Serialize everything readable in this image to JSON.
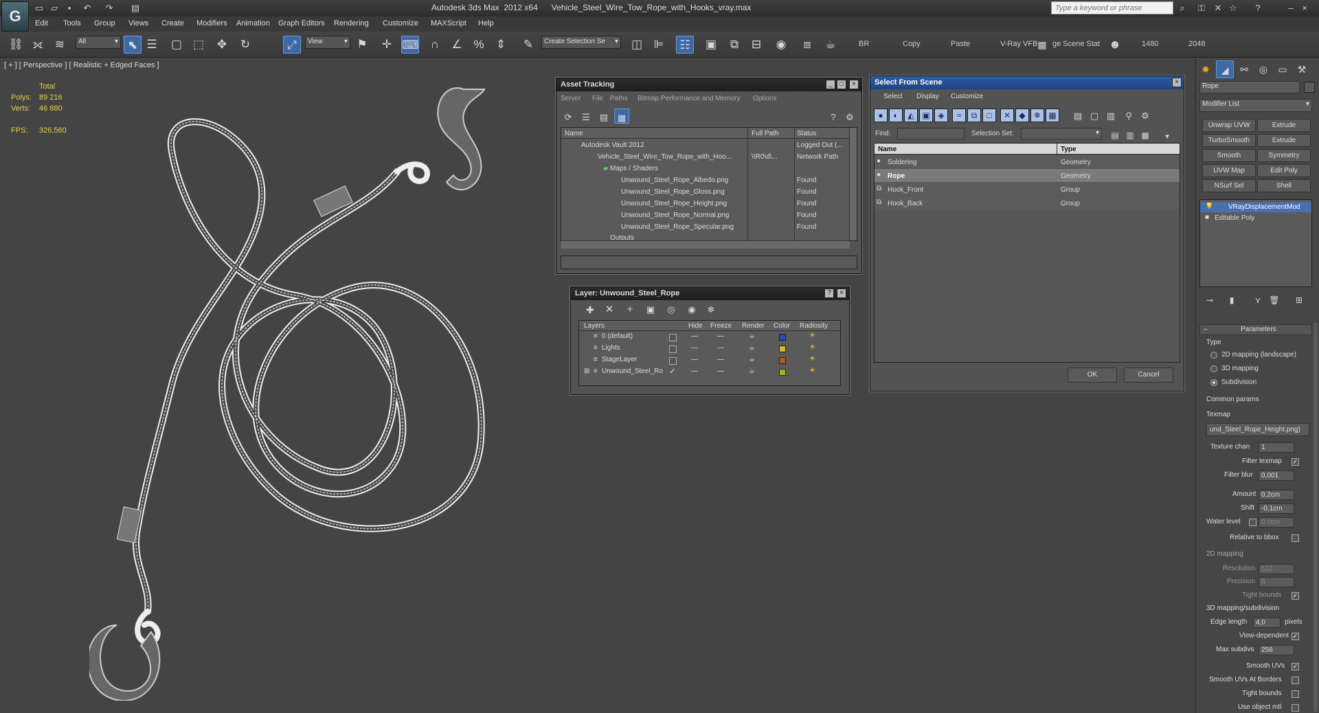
{
  "titlebar": {
    "app": "Autodesk 3ds Max  2012 x64",
    "file": "Vehicle_Steel_Wire_Tow_Rope_with_Hooks_vray.max",
    "search_placeholder": "Type a keyword or phrase"
  },
  "menu": [
    "Edit",
    "Tools",
    "Group",
    "Views",
    "Create",
    "Modifiers",
    "Animation",
    "Graph Editors",
    "Rendering",
    "Customize",
    "MAXScript",
    "Help"
  ],
  "toolbar": {
    "filter": "All",
    "view": "View",
    "selection_set": "Create Selection Se",
    "br": "BR",
    "copy": "Copy",
    "paste": "Paste",
    "vfb": "V-Ray VFB",
    "scene_stat": "ge Scene Stat",
    "w": "1480",
    "h": "2048"
  },
  "viewport": {
    "label": "[ + ] [ Perspective ] [ Realistic + Edged Faces ]",
    "total": "Total",
    "polys_label": "Polys:",
    "polys": "89 216",
    "verts_label": "Verts:",
    "verts": "46 880",
    "fps_label": "FPS:",
    "fps": "326,560"
  },
  "asset_tracking": {
    "title": "Asset Tracking",
    "menus": [
      "Server",
      "File",
      "Paths",
      "Bitmap Performance and Memory",
      "Options"
    ],
    "headers": [
      "Name",
      "Full Path",
      "Status"
    ],
    "rows": [
      {
        "name": "Autodesk Vault 2012",
        "path": "",
        "status": "Logged Out (..."
      },
      {
        "name": "Vehicle_Steel_Wire_Tow_Rope_with_Hoo...",
        "path": "\\\\R0\\d\\...",
        "status": "Network Path"
      },
      {
        "name": "Maps / Shaders",
        "path": "",
        "status": ""
      },
      {
        "name": "Unwound_Steel_Rope_Albedo.png",
        "path": "",
        "status": "Found"
      },
      {
        "name": "Unwound_Steel_Rope_Gloss.png",
        "path": "",
        "status": "Found"
      },
      {
        "name": "Unwound_Steel_Rope_Height.png",
        "path": "",
        "status": "Found"
      },
      {
        "name": "Unwound_Steel_Rope_Normal.png",
        "path": "",
        "status": "Found"
      },
      {
        "name": "Unwound_Steel_Rope_Specular.png",
        "path": "",
        "status": "Found"
      },
      {
        "name": "Outputs",
        "path": "",
        "status": ""
      }
    ]
  },
  "select_scene": {
    "title": "Select From Scene",
    "menus": [
      "Select",
      "Display",
      "Customize"
    ],
    "find_label": "Find:",
    "selset_label": "Selection Set:",
    "headers": [
      "Name",
      "Type"
    ],
    "rows": [
      {
        "name": "Soldering",
        "type": "Geometry"
      },
      {
        "name": "Rope",
        "type": "Geometry"
      },
      {
        "name": "Hook_Front",
        "type": "Group"
      },
      {
        "name": "Hook_Back",
        "type": "Group"
      }
    ],
    "ok": "OK",
    "cancel": "Cancel"
  },
  "layer": {
    "title": "Layer: Unwound_Steel_Rope",
    "headers": [
      "Layers",
      "Hide",
      "Freeze",
      "Render",
      "Color",
      "Radiosity"
    ],
    "rows": [
      {
        "name": "0 (default)",
        "color": "#2a4ab0"
      },
      {
        "name": "Lights",
        "color": "#d8b428"
      },
      {
        "name": "StageLayer",
        "color": "#b4561c"
      },
      {
        "name": "Unwound_Steel_Ro",
        "color": "#9ab820"
      }
    ]
  },
  "cmd": {
    "object_name": "Rope",
    "modifier_list": "Modifier List",
    "buttons": [
      "Unwrap UVW",
      "Extrude",
      "TurboSmooth",
      "Extrude",
      "Smooth",
      "Symmetry",
      "UVW Map",
      "Edit Poly",
      "NSurf Sel",
      "Shell"
    ],
    "stack": [
      "VRayDisplacementMod",
      "Editable Poly"
    ],
    "params_title": "Parameters",
    "type_label": "Type",
    "type_opts": [
      "2D mapping (landscape)",
      "3D mapping",
      "Subdivision"
    ],
    "common": "Common params",
    "texmap": "Texmap",
    "texmap_val": "und_Steel_Rope_Height.png)",
    "texture_chan": "Texture chan",
    "texture_chan_val": "1",
    "filter_texmap": "Filter texmap",
    "filter_blur": "Filter blur",
    "filter_blur_val": "0,001",
    "amount": "Amount",
    "amount_val": "0,2cm",
    "shift": "Shift",
    "shift_val": "-0,1cm",
    "water": "Water level",
    "water_val": "0,0cm",
    "relative": "Relative to bbox",
    "map2d": "2D mapping",
    "resolution": "Resolution",
    "resolution_val": "512",
    "precision": "Precision",
    "precision_val": "8",
    "tight": "Tight bounds",
    "map3d": "3D mapping/subdivision",
    "edge": "Edge length",
    "edge_val": "4,0",
    "pixels": "pixels",
    "viewdep": "View-dependent",
    "maxsub": "Max subdivs",
    "maxsub_val": "256",
    "smoothuv": "Smooth UVs",
    "smoothborder": "Smooth UVs At Borders",
    "tight2": "Tight bounds",
    "useobj": "Use object mtl"
  }
}
